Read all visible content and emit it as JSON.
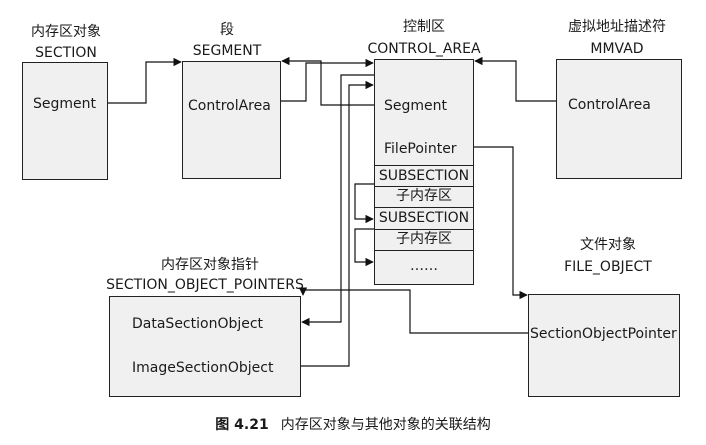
{
  "section": {
    "title_cn": "内存区对象",
    "title_en": "SECTION",
    "field": "Segment"
  },
  "segment": {
    "title_cn": "段",
    "title_en": "SEGMENT",
    "field": "ControlArea"
  },
  "control_area": {
    "title_cn": "控制区",
    "title_en": "CONTROL_AREA",
    "field_segment": "Segment",
    "field_filepointer": "FilePointer",
    "subsections": [
      {
        "name": "SUBSECTION",
        "desc": "子内存区"
      },
      {
        "name": "SUBSECTION",
        "desc": "子内存区"
      }
    ],
    "more": "……"
  },
  "mmvad": {
    "title_cn": "虚拟地址描述符",
    "title_en": "MMVAD",
    "field": "ControlArea"
  },
  "sop": {
    "title_cn": "内存区对象指针",
    "title_en": "SECTION_OBJECT_POINTERS",
    "field_data": "DataSectionObject",
    "field_image": "ImageSectionObject"
  },
  "file_object": {
    "title_cn": "文件对象",
    "title_en": "FILE_OBJECT",
    "field": "SectionObjectPointer"
  },
  "caption": {
    "number": "图 4.21",
    "text": "内存区对象与其他对象的关联结构"
  }
}
